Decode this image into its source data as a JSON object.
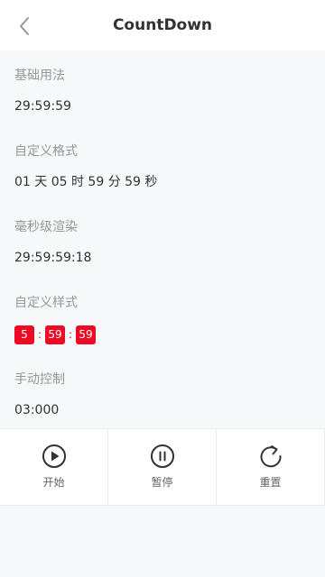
{
  "nav": {
    "title": "CountDown",
    "back_icon": "chevron-left-icon"
  },
  "sections": [
    {
      "title": "基础用法",
      "value": "29:59:59"
    },
    {
      "title": "自定义格式",
      "value": "01 天 05 时 59 分 59 秒"
    },
    {
      "title": "毫秒级渲染",
      "value": "29:59:59:18"
    },
    {
      "title": "自定义样式",
      "blocks": [
        "5",
        "59",
        "59"
      ],
      "separator": ":"
    },
    {
      "title": "手动控制",
      "value": "03:000"
    }
  ],
  "controls": [
    {
      "label": "开始",
      "icon": "play-circle-icon"
    },
    {
      "label": "暂停",
      "icon": "pause-circle-icon"
    },
    {
      "label": "重置",
      "icon": "replay-icon"
    }
  ],
  "colors": {
    "block_bg": "#ee0a24",
    "section_title": "#969799",
    "text": "#323233"
  }
}
